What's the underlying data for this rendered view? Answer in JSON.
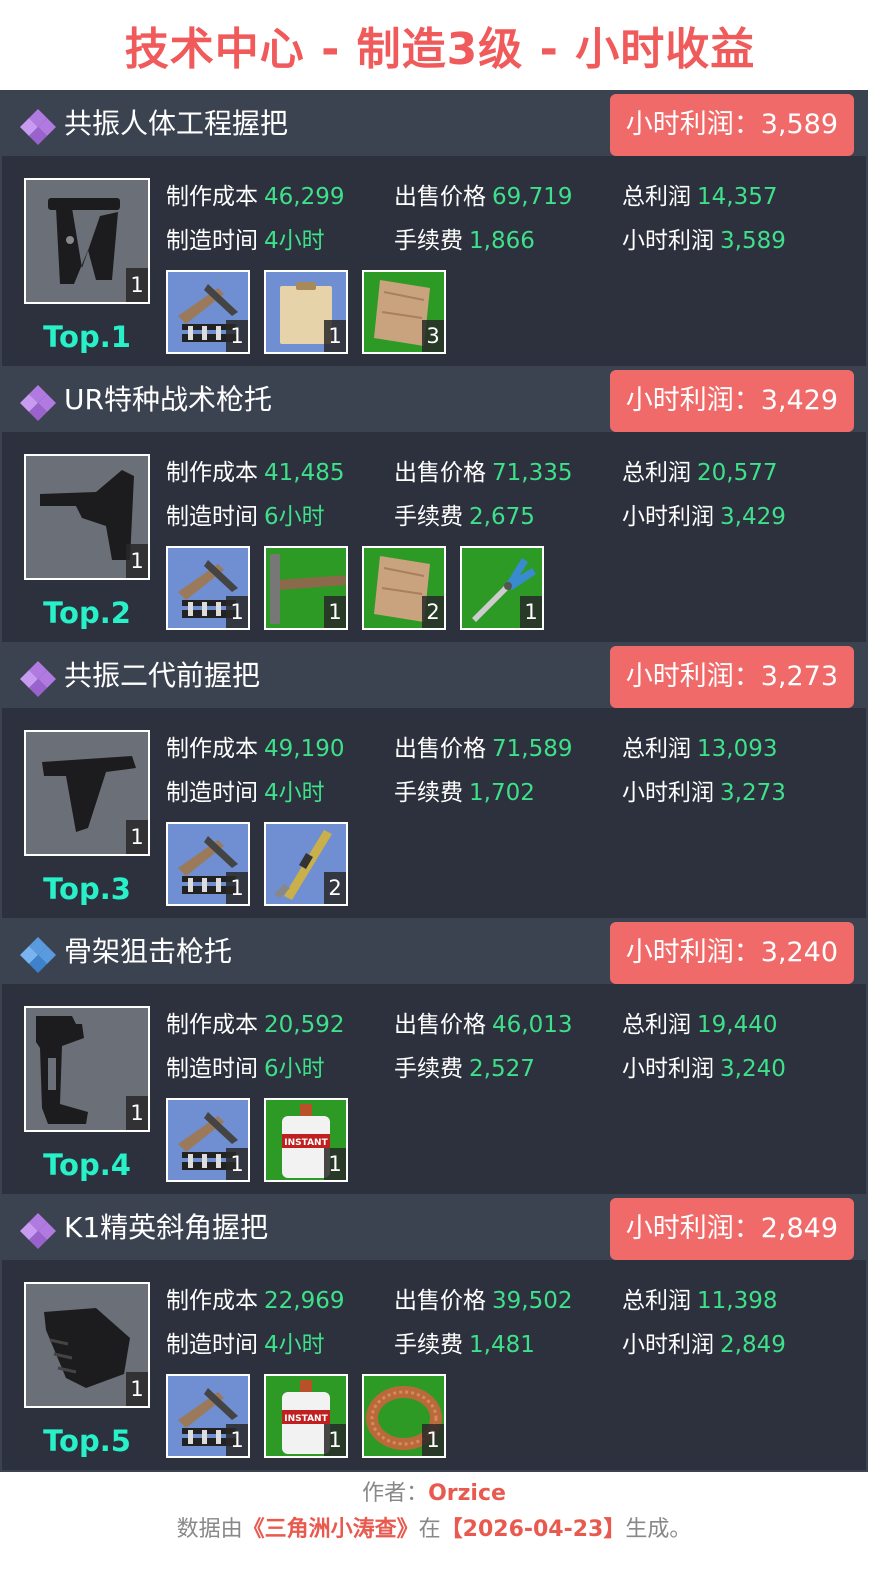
{
  "title": "技术中心 - 制造3级 - 小时收益",
  "labels": {
    "cost": "制作成本",
    "price": "出售价格",
    "total_profit": "总利润",
    "time": "制造时间",
    "fee": "手续费",
    "hourly_profit": "小时利润"
  },
  "colors": {
    "title": "#f05a5a",
    "badge": "#f06a6a",
    "value": "#3ee08a",
    "rank": "#28f0c8",
    "rarity_purple": "#b07ae0",
    "rarity_blue": "#5a9be0"
  },
  "items": [
    {
      "name": "共振人体工程握把",
      "rarity_icon": "purple-diamond-icon",
      "badge": "小时利润：3,589",
      "cost": "46,299",
      "price": "69,719",
      "total_profit": "14,357",
      "time": "4小时",
      "fee": "1,866",
      "hourly_profit": "3,589",
      "rank": "Top.1",
      "product_icon": "ergonomic-grip-icon",
      "product_qty": "1",
      "materials": [
        {
          "icon": "gun-parts-icon",
          "qty": "1",
          "bg": "blue"
        },
        {
          "icon": "clipboard-icon",
          "qty": "1",
          "bg": "blue"
        },
        {
          "icon": "wood-plank-icon",
          "qty": "3",
          "bg": "green"
        }
      ]
    },
    {
      "name": "UR特种战术枪托",
      "rarity_icon": "purple-diamond-icon",
      "badge": "小时利润：3,429",
      "cost": "41,485",
      "price": "71,335",
      "total_profit": "20,577",
      "time": "6小时",
      "fee": "2,675",
      "hourly_profit": "3,429",
      "rank": "Top.2",
      "product_icon": "rifle-stock-icon",
      "product_qty": "1",
      "materials": [
        {
          "icon": "gun-parts-icon",
          "qty": "1",
          "bg": "blue"
        },
        {
          "icon": "hammer-icon",
          "qty": "1",
          "bg": "green"
        },
        {
          "icon": "wood-plank-icon",
          "qty": "2",
          "bg": "green"
        },
        {
          "icon": "pliers-icon",
          "qty": "1",
          "bg": "green"
        }
      ]
    },
    {
      "name": "共振二代前握把",
      "rarity_icon": "purple-diamond-icon",
      "badge": "小时利润：3,273",
      "cost": "49,190",
      "price": "71,589",
      "total_profit": "13,093",
      "time": "4小时",
      "fee": "1,702",
      "hourly_profit": "3,273",
      "rank": "Top.3",
      "product_icon": "angled-grip-icon",
      "product_qty": "1",
      "materials": [
        {
          "icon": "gun-parts-icon",
          "qty": "1",
          "bg": "blue"
        },
        {
          "icon": "caliper-icon",
          "qty": "2",
          "bg": "blue"
        }
      ]
    },
    {
      "name": "骨架狙击枪托",
      "rarity_icon": "blue-diamond-icon",
      "badge": "小时利润：3,240",
      "cost": "20,592",
      "price": "46,013",
      "total_profit": "19,440",
      "time": "6小时",
      "fee": "2,527",
      "hourly_profit": "3,240",
      "rank": "Top.4",
      "product_icon": "skeleton-stock-icon",
      "product_qty": "1",
      "materials": [
        {
          "icon": "gun-parts-icon",
          "qty": "1",
          "bg": "blue"
        },
        {
          "icon": "glue-bottle-icon",
          "qty": "1",
          "bg": "green",
          "text": "INSTANT"
        }
      ]
    },
    {
      "name": "K1精英斜角握把",
      "rarity_icon": "purple-diamond-icon",
      "badge": "小时利润：2,849",
      "cost": "22,969",
      "price": "39,502",
      "total_profit": "11,398",
      "time": "4小时",
      "fee": "1,481",
      "hourly_profit": "2,849",
      "rank": "Top.5",
      "product_icon": "handstop-grip-icon",
      "product_qty": "1",
      "materials": [
        {
          "icon": "gun-parts-icon",
          "qty": "1",
          "bg": "blue"
        },
        {
          "icon": "glue-bottle-icon",
          "qty": "1",
          "bg": "green",
          "text": "INSTANT"
        },
        {
          "icon": "copper-wire-icon",
          "qty": "1",
          "bg": "green"
        }
      ]
    }
  ],
  "footer": {
    "author_prefix": "作者：",
    "author": "Orzice",
    "source_prefix": "数据由",
    "source": "《三角洲小涛查》",
    "date_prefix": "在",
    "date": "【2026-04-23】",
    "suffix": "生成。"
  }
}
